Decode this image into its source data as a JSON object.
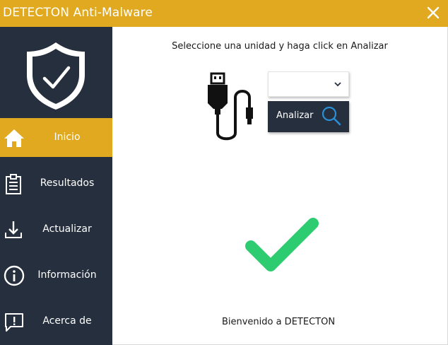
{
  "window": {
    "title": "DETECTON Anti-Malware",
    "accent_color": "#e0a91f",
    "sidebar_color": "#262f3d"
  },
  "sidebar": {
    "logo_icon": "shield-check-icon",
    "items": [
      {
        "label": "Inicio",
        "icon": "home-icon",
        "active": true
      },
      {
        "label": "Resultados",
        "icon": "clipboard-icon",
        "active": false
      },
      {
        "label": "Actualizar",
        "icon": "download-icon",
        "active": false
      },
      {
        "label": "Información",
        "icon": "info-icon",
        "active": false
      },
      {
        "label": "Acerca de",
        "icon": "message-alert-icon",
        "active": false
      }
    ]
  },
  "main": {
    "instruction": "Seleccione una unidad y haga click en Analizar",
    "drive_select": {
      "value": ""
    },
    "scan_button_label": "Analizar",
    "status_icon": "check-icon",
    "status_color": "#2ecc71",
    "welcome": "Bienvenido a DETECTON"
  }
}
